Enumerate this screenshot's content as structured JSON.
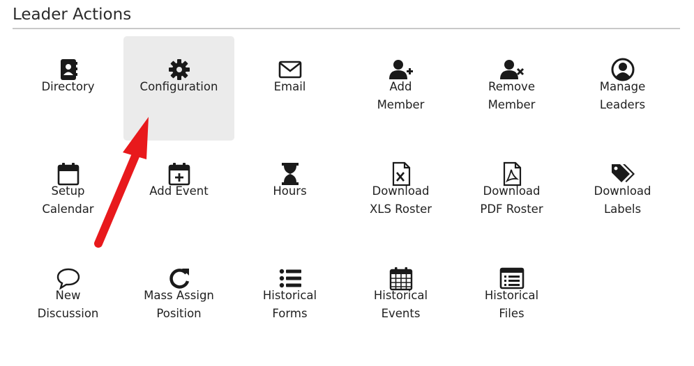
{
  "section": {
    "title": "Leader Actions"
  },
  "tiles": [
    {
      "label_1": "Directory",
      "label_2": ""
    },
    {
      "label_1": "Configuration",
      "label_2": ""
    },
    {
      "label_1": "Email",
      "label_2": ""
    },
    {
      "label_1": "Add",
      "label_2": "Member"
    },
    {
      "label_1": "Remove",
      "label_2": "Member"
    },
    {
      "label_1": "Manage",
      "label_2": "Leaders"
    },
    {
      "label_1": "Setup",
      "label_2": "Calendar"
    },
    {
      "label_1": "Add Event",
      "label_2": ""
    },
    {
      "label_1": "Hours",
      "label_2": ""
    },
    {
      "label_1": "Download",
      "label_2": "XLS Roster"
    },
    {
      "label_1": "Download",
      "label_2": "PDF Roster"
    },
    {
      "label_1": "Download",
      "label_2": "Labels"
    },
    {
      "label_1": "New",
      "label_2": "Discussion"
    },
    {
      "label_1": "Mass Assign",
      "label_2": "Position"
    },
    {
      "label_1": "Historical",
      "label_2": "Forms"
    },
    {
      "label_1": "Historical",
      "label_2": "Events"
    },
    {
      "label_1": "Historical",
      "label_2": "Files"
    }
  ],
  "colors": {
    "icon": "#1a1a1a",
    "highlight_bg": "#ebebeb",
    "arrow": "#e8191c",
    "divider": "#c8c8c8"
  },
  "icons": [
    "address-book-icon",
    "gear-icon",
    "envelope-icon",
    "user-plus-icon",
    "user-remove-icon",
    "user-circle-icon",
    "calendar-icon",
    "calendar-plus-icon",
    "hourglass-icon",
    "xls-file-icon",
    "pdf-file-icon",
    "tags-icon",
    "speech-bubble-icon",
    "redo-icon",
    "list-icon",
    "calendar-grid-icon",
    "list-alt-icon"
  ],
  "annotation": {
    "type": "arrow",
    "points_to": "Configuration"
  }
}
